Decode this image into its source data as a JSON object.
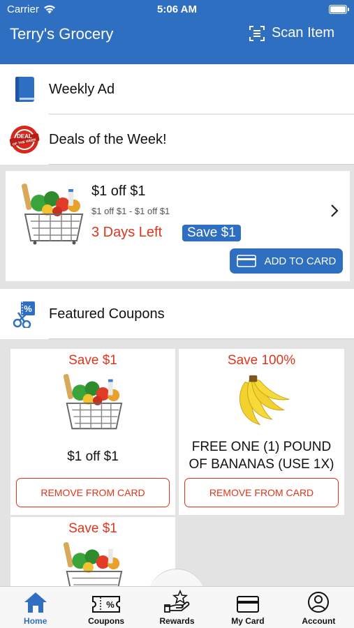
{
  "status": {
    "carrier": "Carrier",
    "time": "5:06 AM"
  },
  "header": {
    "title": "Terry's Grocery",
    "scan_label": "Scan Item"
  },
  "menu": {
    "weekly_ad": "Weekly Ad",
    "deals": "Deals of the Week!",
    "featured": "Featured Coupons"
  },
  "deal": {
    "title": "$1 off $1",
    "subtitle": "$1 off $1 - $1 off $1",
    "days_left": "3 Days Left",
    "save": "Save $1",
    "add_button": "ADD TO CARD"
  },
  "coupons": [
    {
      "save": "Save $1",
      "desc": "$1 off $1",
      "button": "REMOVE FROM CARD"
    },
    {
      "save": "Save 100%",
      "desc": "FREE ONE (1) POUND OF BANANAS (USE 1X)",
      "button": "REMOVE FROM CARD"
    },
    {
      "save": "Save $1"
    }
  ],
  "tabs": [
    {
      "label": "Home",
      "icon": "home-icon"
    },
    {
      "label": "Coupons",
      "icon": "coupon-icon"
    },
    {
      "label": "Rewards",
      "icon": "rewards-icon"
    },
    {
      "label": "My Card",
      "icon": "card-icon"
    },
    {
      "label": "Account",
      "icon": "account-icon"
    }
  ],
  "colors": {
    "brand": "#2f6fc1",
    "alert": "#e0351b",
    "background": "#e3e3e3"
  }
}
